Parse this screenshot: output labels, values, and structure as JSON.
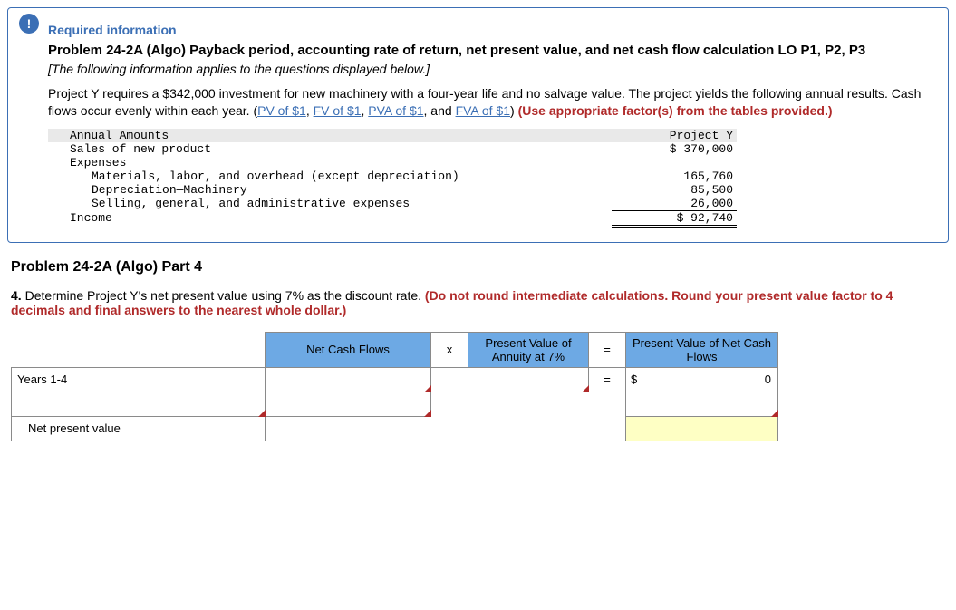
{
  "badge": "!",
  "req_info": "Required information",
  "title": "Problem 24-2A (Algo) Payback period, accounting rate of return, net present value, and net cash flow calculation LO P1, P2, P3",
  "applies_note": "[The following information applies to the questions displayed below.]",
  "intro_pre": "Project Y requires a $342,000 investment for new machinery with a four-year life and no salvage value. The project yields the following annual results. Cash flows occur evenly within each year. (",
  "links": {
    "pv": "PV of $1",
    "fv": "FV of $1",
    "pva": "PVA of $1",
    "fva": "FVA of $1"
  },
  "sep": ", ",
  "and": ", and ",
  "intro_post": ") ",
  "use_factors": "(Use appropriate factor(s) from the tables provided.)",
  "amounts": {
    "h_label": "Annual Amounts",
    "h_proj": "Project Y",
    "sales_l": "Sales of new product",
    "sales_v": "$ 370,000",
    "exp_l": "Expenses",
    "mat_l": "Materials, labor, and overhead (except depreciation)",
    "mat_v": "165,760",
    "dep_l": "Depreciation—Machinery",
    "dep_v": "85,500",
    "sga_l": "Selling, general, and administrative expenses",
    "sga_v": "26,000",
    "inc_l": "Income",
    "inc_v": "$ 92,740"
  },
  "part_title": "Problem 24-2A (Algo) Part 4",
  "q_num": "4. ",
  "q_text": "Determine Project Y's net present value using 7% as the discount rate. ",
  "q_red": "(Do not round intermediate calculations. Round your present value factor to 4 decimals and final answers to the nearest whole dollar.)",
  "calc": {
    "h_ncf": "Net Cash Flows",
    "h_x": "x",
    "h_pva": "Present Value of Annuity at 7%",
    "h_eq": "=",
    "h_pvn": "Present Value of Net Cash Flows",
    "row1_label": "Years 1-4",
    "row_eq": "=",
    "row_dollar": "$",
    "row_zero": "0",
    "npv_label": "Net present value"
  }
}
